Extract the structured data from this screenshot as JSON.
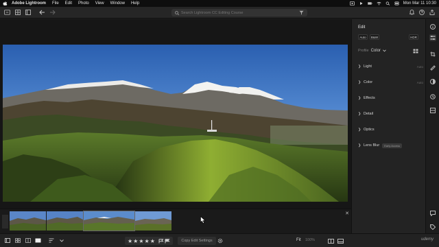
{
  "menubar": {
    "app_name": "Adobe Lightroom",
    "items": [
      "File",
      "Edit",
      "Photo",
      "View",
      "Window",
      "Help"
    ],
    "clock": "Mon Mar 11  10:30"
  },
  "toolbar": {
    "search_placeholder": "Search Lightroom CC Editing Course"
  },
  "panel": {
    "title": "Edit",
    "buttons": {
      "auto": "Auto",
      "bw": "B&W",
      "hdr": "HDR"
    },
    "profile_label": "Profile",
    "profile_value": "Color",
    "sections": [
      {
        "label": "Light",
        "auto": "Auto"
      },
      {
        "label": "Color",
        "auto": "Auto"
      },
      {
        "label": "Effects",
        "auto": ""
      },
      {
        "label": "Detail",
        "auto": ""
      },
      {
        "label": "Optics",
        "auto": ""
      },
      {
        "label": "Lens Blur",
        "auto": "",
        "badge": "Early Access"
      }
    ]
  },
  "bottombar": {
    "stars": "★★★★★",
    "copy_label": "Copy Edit Settings",
    "fit_label": "Fit",
    "zoom_label": "100%"
  },
  "watermark": "udemy",
  "colors": {
    "accent": "#2f6fd6",
    "panel_bg": "#232323",
    "canvas_bg": "#161616"
  }
}
